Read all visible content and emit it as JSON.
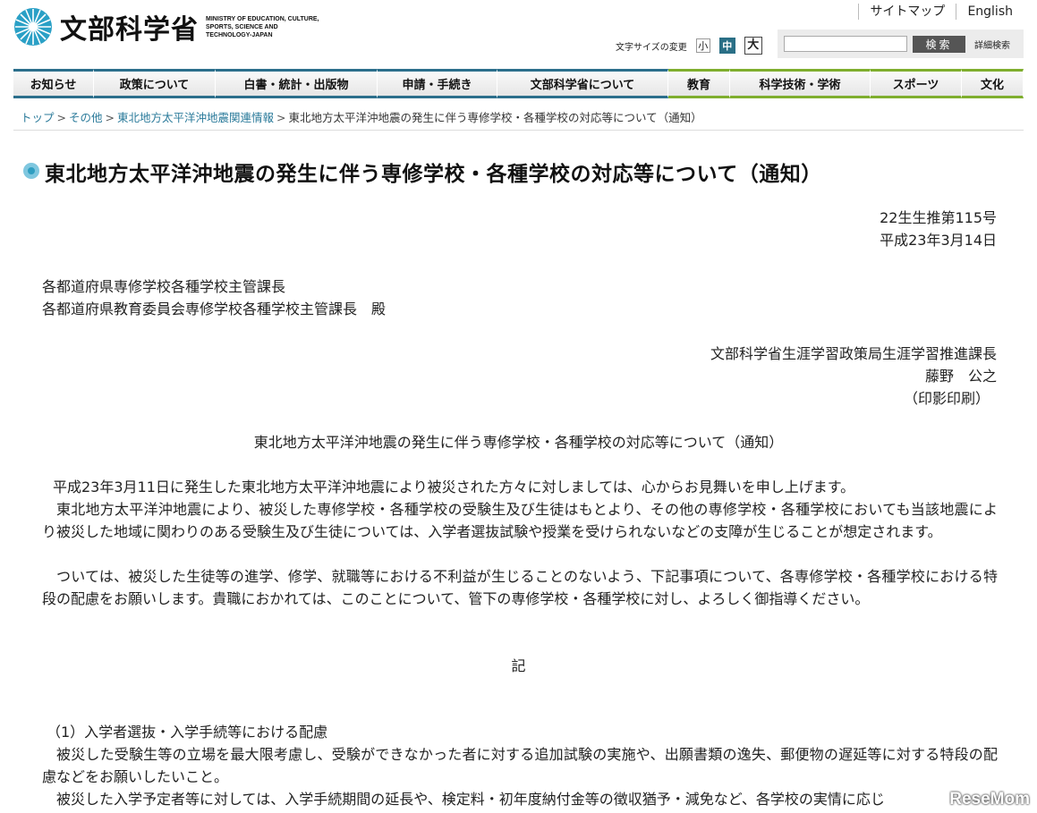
{
  "header": {
    "logo_ja": "文部科学省",
    "logo_en": "MINISTRY OF EDUCATION, CULTURE, SPORTS, SCIENCE AND TECHNOLOGY-JAPAN",
    "links": [
      "サイトマップ",
      "English"
    ],
    "font_size_label": "文字サイズの変更",
    "font_sizes": [
      "小",
      "中",
      "大"
    ],
    "font_size_selected": "中",
    "search": {
      "placeholder": "",
      "value": "",
      "button": "検索",
      "advanced": "詳細検索"
    }
  },
  "nav": {
    "items": [
      "お知らせ",
      "政策について",
      "白書・統計・出版物",
      "申請・手続き",
      "文部科学省について",
      "教育",
      "科学技術・学術",
      "スポーツ",
      "文化"
    ],
    "accent_blue": "#2c6f8c",
    "accent_green": "#7fae2e"
  },
  "breadcrumb": {
    "links": [
      "トップ",
      "その他",
      "東北地方太平洋沖地震関連情報"
    ],
    "current": "東北地方太平洋沖地震の発生に伴う専修学校・各種学校の対応等について（通知）",
    "separator": ">"
  },
  "page": {
    "title": "東北地方太平洋沖地震の発生に伴う専修学校・各種学校の対応等について（通知）",
    "doc_number": "22生生推第115号",
    "date": "平成23年3月14日",
    "addressee_1": "各都道府県専修学校各種学校主管課長",
    "addressee_2": "各都道府県教育委員会専修学校各種学校主管課長　殿",
    "sender_1": "文部科学省生涯学習政策局生涯学習推進課長",
    "sender_2": "藤野　公之",
    "sender_3": "（印影印刷）",
    "subject": "東北地方太平洋沖地震の発生に伴う専修学校・各種学校の対応等について（通知）",
    "para_1": "平成23年3月11日に発生した東北地方太平洋沖地震により被災された方々に対しましては、心からお見舞いを申し上げます。",
    "para_2": "東北地方太平洋沖地震により、被災した専修学校・各種学校の受験生及び生徒はもとより、その他の専修学校・各種学校においても当該地震により被災した地域に関わりのある受験生及び生徒については、入学者選抜試験や授業を受けられないなどの支障が生じることが想定されます。",
    "para_3": "ついては、被災した生徒等の進学、修学、就職等における不利益が生じることのないよう、下記事項について、各専修学校・各種学校における特段の配慮をお願いします。貴職におかれては、このことについて、管下の専修学校・各種学校に対し、よろしく御指導ください。",
    "ki": "記",
    "section_1_heading": "（1）入学者選抜・入学手続等における配慮",
    "section_1_para_1": "被災した受験生等の立場を最大限考慮し、受験ができなかった者に対する追加試験の実施や、出願書類の逸失、郵便物の遅延等に対する特段の配慮などをお願いしたいこと。",
    "section_1_para_2": "被災した入学予定者等に対しては、入学手続期間の延長や、検定料・初年度納付金等の徴収猶予・減免など、各学校の実情に応じ"
  },
  "watermark": "ReseMom"
}
